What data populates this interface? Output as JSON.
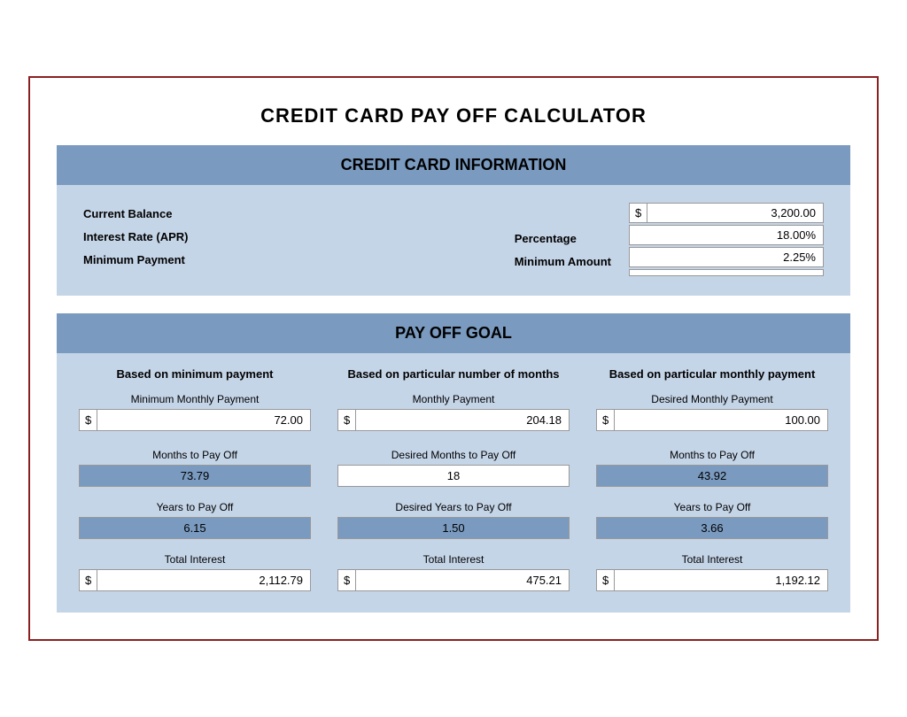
{
  "title": "CREDIT CARD PAY OFF CALCULATOR",
  "sections": {
    "credit_info": {
      "header": "CREDIT CARD INFORMATION",
      "labels": {
        "balance": "Current Balance",
        "interest": "Interest Rate (APR)",
        "min_payment": "Minimum Payment"
      },
      "middle_labels": {
        "percentage": "Percentage",
        "min_amount": "Minimum Amount"
      },
      "values": {
        "balance_symbol": "$",
        "balance_amount": "3,200.00",
        "interest_rate": "18.00%",
        "percentage": "2.25%",
        "min_amount": ""
      }
    },
    "payoff_goal": {
      "header": "PAY OFF GOAL",
      "col1": {
        "header": "Based on minimum payment",
        "field1_label": "Minimum Monthly Payment",
        "field1_symbol": "$",
        "field1_value": "72.00",
        "field2_label": "Months to Pay Off",
        "field2_value": "73.79",
        "field3_label": "Years to Pay Off",
        "field3_value": "6.15",
        "field4_label": "Total Interest",
        "field4_symbol": "$",
        "field4_value": "2,112.79"
      },
      "col2": {
        "header": "Based on particular number of months",
        "field1_label": "Monthly Payment",
        "field1_symbol": "$",
        "field1_value": "204.18",
        "field2_label": "Desired Months to Pay Off",
        "field2_value": "18",
        "field3_label": "Desired Years to Pay Off",
        "field3_value": "1.50",
        "field4_label": "Total Interest",
        "field4_symbol": "$",
        "field4_value": "475.21"
      },
      "col3": {
        "header": "Based on particular monthly payment",
        "field1_label": "Desired Monthly Payment",
        "field1_symbol": "$",
        "field1_value": "100.00",
        "field2_label": "Months to Pay Off",
        "field2_value": "43.92",
        "field3_label": "Years to Pay Off",
        "field3_value": "3.66",
        "field4_label": "Total Interest",
        "field4_symbol": "$",
        "field4_value": "1,192.12"
      }
    }
  }
}
